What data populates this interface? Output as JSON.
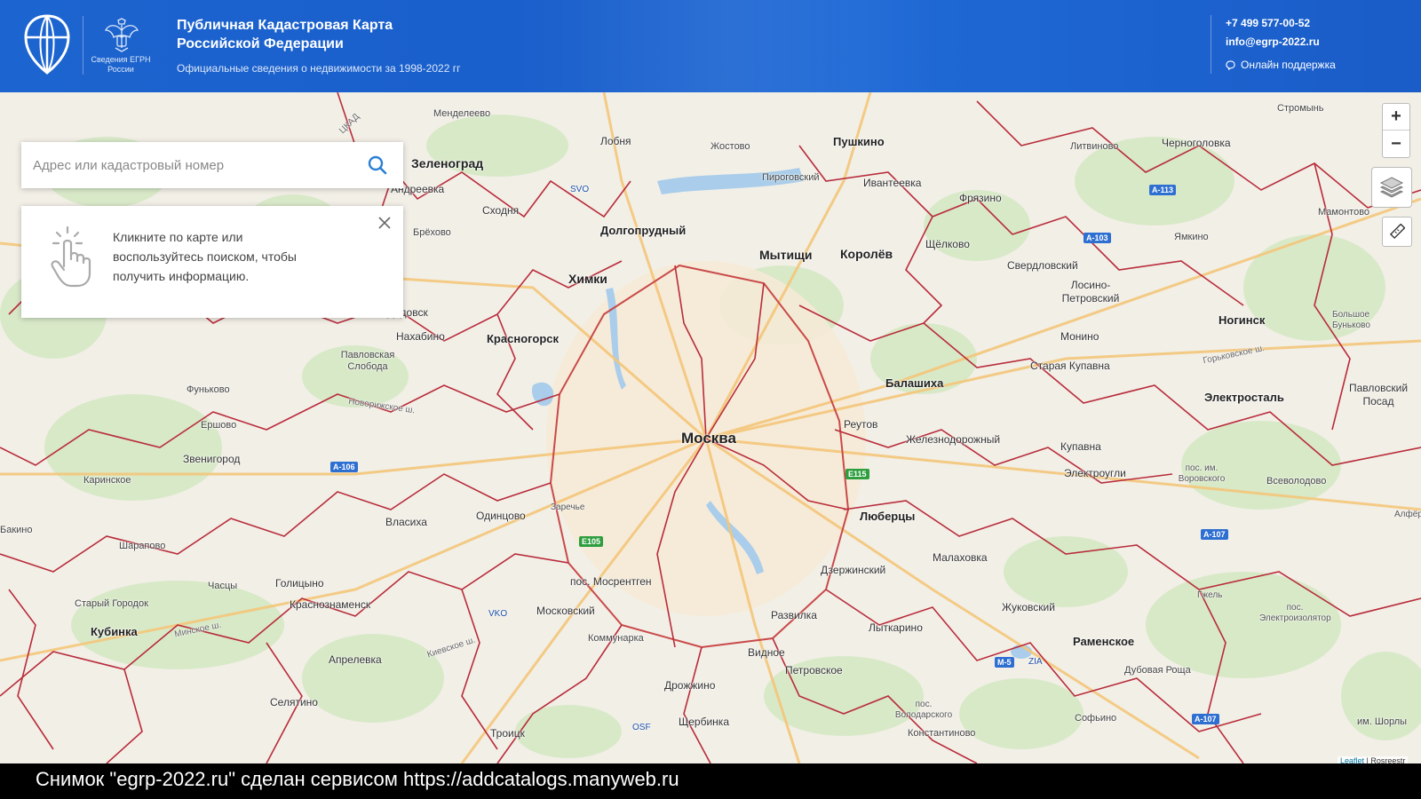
{
  "header": {
    "emblem_caption": "Сведения ЕГРН России",
    "title": "Публичная Кадастровая Карта Российской Федерации",
    "subtitle": "Официальные сведения о недвижимости за 1998-2022 гг",
    "phone": "+7 499 577-00-52",
    "email": "info@egrp-2022.ru",
    "support": "Онлайн поддержка",
    "icons": {
      "logo": "shield-globe-icon",
      "emblem": "double-eagle-emblem-icon",
      "support": "chat-bubble-icon"
    }
  },
  "search": {
    "placeholder": "Адрес или кадастровый номер",
    "icon": "search-icon"
  },
  "info_box": {
    "message": "Кликните по карте или воспользуйтесь поиском, чтобы получить информацию.",
    "icons": {
      "hand": "tap-hand-icon",
      "close": "close-icon"
    }
  },
  "map_controls": {
    "zoom_in": "+",
    "zoom_out": "−",
    "icons": {
      "layers": "layers-icon",
      "ruler": "ruler-icon"
    }
  },
  "attribution": {
    "leaflet": "Leaflet",
    "rest": "| Rosreestr"
  },
  "map_labels": {
    "moskva": "Москва",
    "zelenograd": "Зеленоград",
    "andreevka": "Андреевка",
    "mendeleevo": "Менделеево",
    "lobnya": "Лобня",
    "zhostovo": "Жостово",
    "pushkino": "Пушкино",
    "stromyn": "Стромынь",
    "chernogolovka": "Черноголовка",
    "litvinovo": "Литвиново",
    "skhodnya": "Сходня",
    "svo": "SVO",
    "pirogovsky": "Пироговский",
    "ivanteevka": "Ивантеевка",
    "fryazino": "Фрязино",
    "mamontovo": "Мамонтово",
    "brekhovo": "Брёхово",
    "dolgoprudny": "Долгопрудный",
    "shchyolkovo": "Щёлково",
    "yamkino": "Ямкино",
    "khimki": "Химки",
    "mytishchi": "Мытищи",
    "korolyov": "Королёв",
    "sverdlovsky": "Свердловский",
    "losino": "Лосино-Петровский",
    "noginsk": "Ногинск",
    "bolshoe_bunkovo": "Большое Буньково",
    "dedovsk": "Дедовск",
    "nakhabino": "Нахабино",
    "krasnogorsk": "Красногорск",
    "monino": "Монино",
    "pavlovskaya_sloboda": "Павловская Слобода",
    "staraya_kupavna": "Старая Купавна",
    "funkovo": "Фуньково",
    "balashikha": "Балашиха",
    "elektrostal": "Электросталь",
    "pavlovsky_posad": "Павловский Посад",
    "ershovo": "Ершово",
    "reutov": "Реутов",
    "zheleznodorozhny": "Железнодорожный",
    "kupavna": "Купавна",
    "zvenigorod": "Звенигород",
    "karinskoe": "Каринское",
    "elektrougli": "Электроугли",
    "vorovskogo": "пос. им. Воровского",
    "vsevolodovo": "Всеволодово",
    "bakino": "Бакино",
    "vlasikha": "Власиха",
    "odintsovo": "Одинцово",
    "lyubertsy": "Люберцы",
    "alfyorovo": "Алфёр",
    "sharapovo": "Шарапово",
    "malakhovka": "Малаховка",
    "chasy": "Часцы",
    "golitsyno": "Голицыно",
    "mosrentgen": "пос. Мосрентген",
    "dzerzhinsky": "Дзержинский",
    "gzhel": "Гжель",
    "stary_gorodok": "Старый Городок",
    "krasnoznamensk": "Краснознаменск",
    "moskovsky": "Московский",
    "zhukovsky": "Жуковский",
    "elektroizolyator": "пос. Электроизолятор",
    "kubinka": "Кубинка",
    "vko": "VKO",
    "kommunarka": "Коммунарка",
    "razvilka": "Развилка",
    "lytkarino": "Лыткарино",
    "ramenskoe": "Раменское",
    "aprelevka": "Апрелевка",
    "vidnoe": "Видное",
    "petrovskoe": "Петровское",
    "zia": "ZIA",
    "dubovaya_roshcha": "Дубовая Роща",
    "selyatino": "Селятино",
    "drozhzhino": "Дрожжино",
    "volodarskogo": "пос. Володарского",
    "sofyino": "Софьино",
    "shuryly": "им. Шорлы",
    "troitsk": "Троицк",
    "osf": "OSF",
    "shcherbinka": "Щербинка",
    "konstantinovo": "Константиново",
    "zarechye": "Заречье",
    "noginsk_sh": "Горьковское ш.",
    "novorizhskoe": "Новорижское ш.",
    "minskoe": "Минское ш.",
    "kievskoe": "Киевское ш.",
    "tskad": "ЦКАД",
    "rd_m5": "М-5",
    "rd_a113": "А-113",
    "rd_a103": "А-103",
    "rd_a106": "А-106",
    "rd_e115": "E115",
    "rd_e105": "E105",
    "rd_a107": "А-107"
  },
  "footer": {
    "caption": "Снимок \"egrp-2022.ru\" сделан сервисом https://addcatalogs.manyweb.ru"
  }
}
